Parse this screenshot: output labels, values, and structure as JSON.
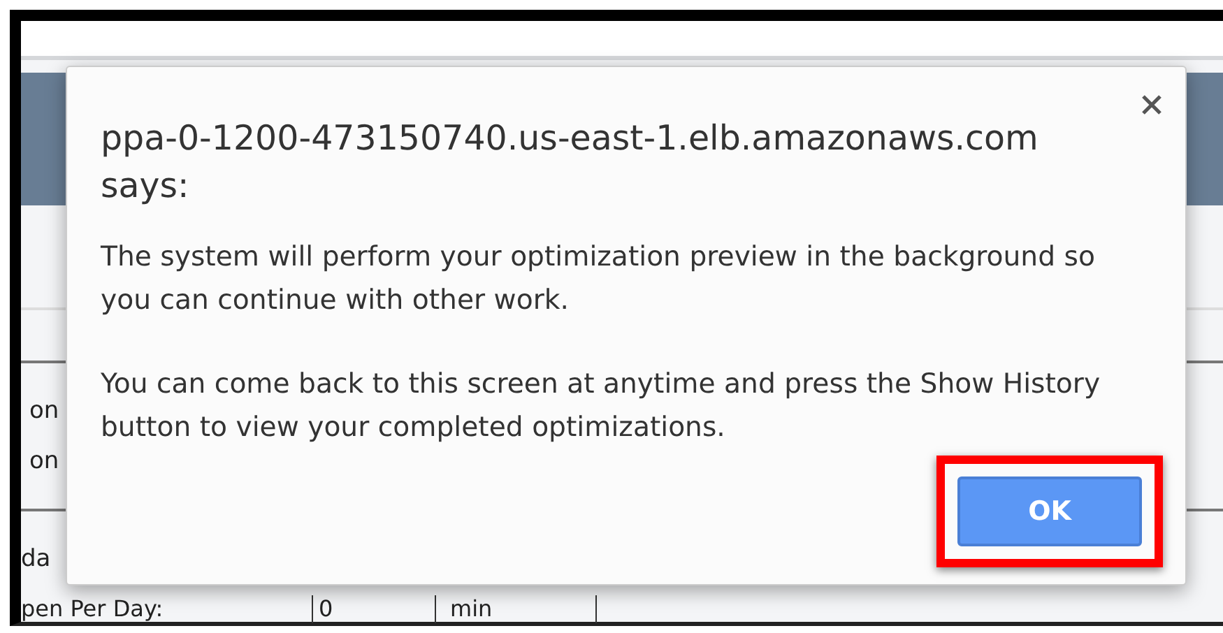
{
  "background": {
    "rows": [
      {
        "text": "on"
      },
      {
        "text": "on"
      }
    ],
    "section_label": "da",
    "field_row": {
      "label": "pen Per Day:",
      "value": "0",
      "unit": "min"
    }
  },
  "dialog": {
    "title": "ppa-0-1200-473150740.us-east-1.elb.amazonaws.com says:",
    "messages": [
      "The system will perform your optimization preview in the background so you can continue with other work.",
      "You can come back to this screen at anytime and press the Show History button to view your completed optimizations."
    ],
    "button": {
      "label": "OK",
      "highlighted": true
    }
  }
}
